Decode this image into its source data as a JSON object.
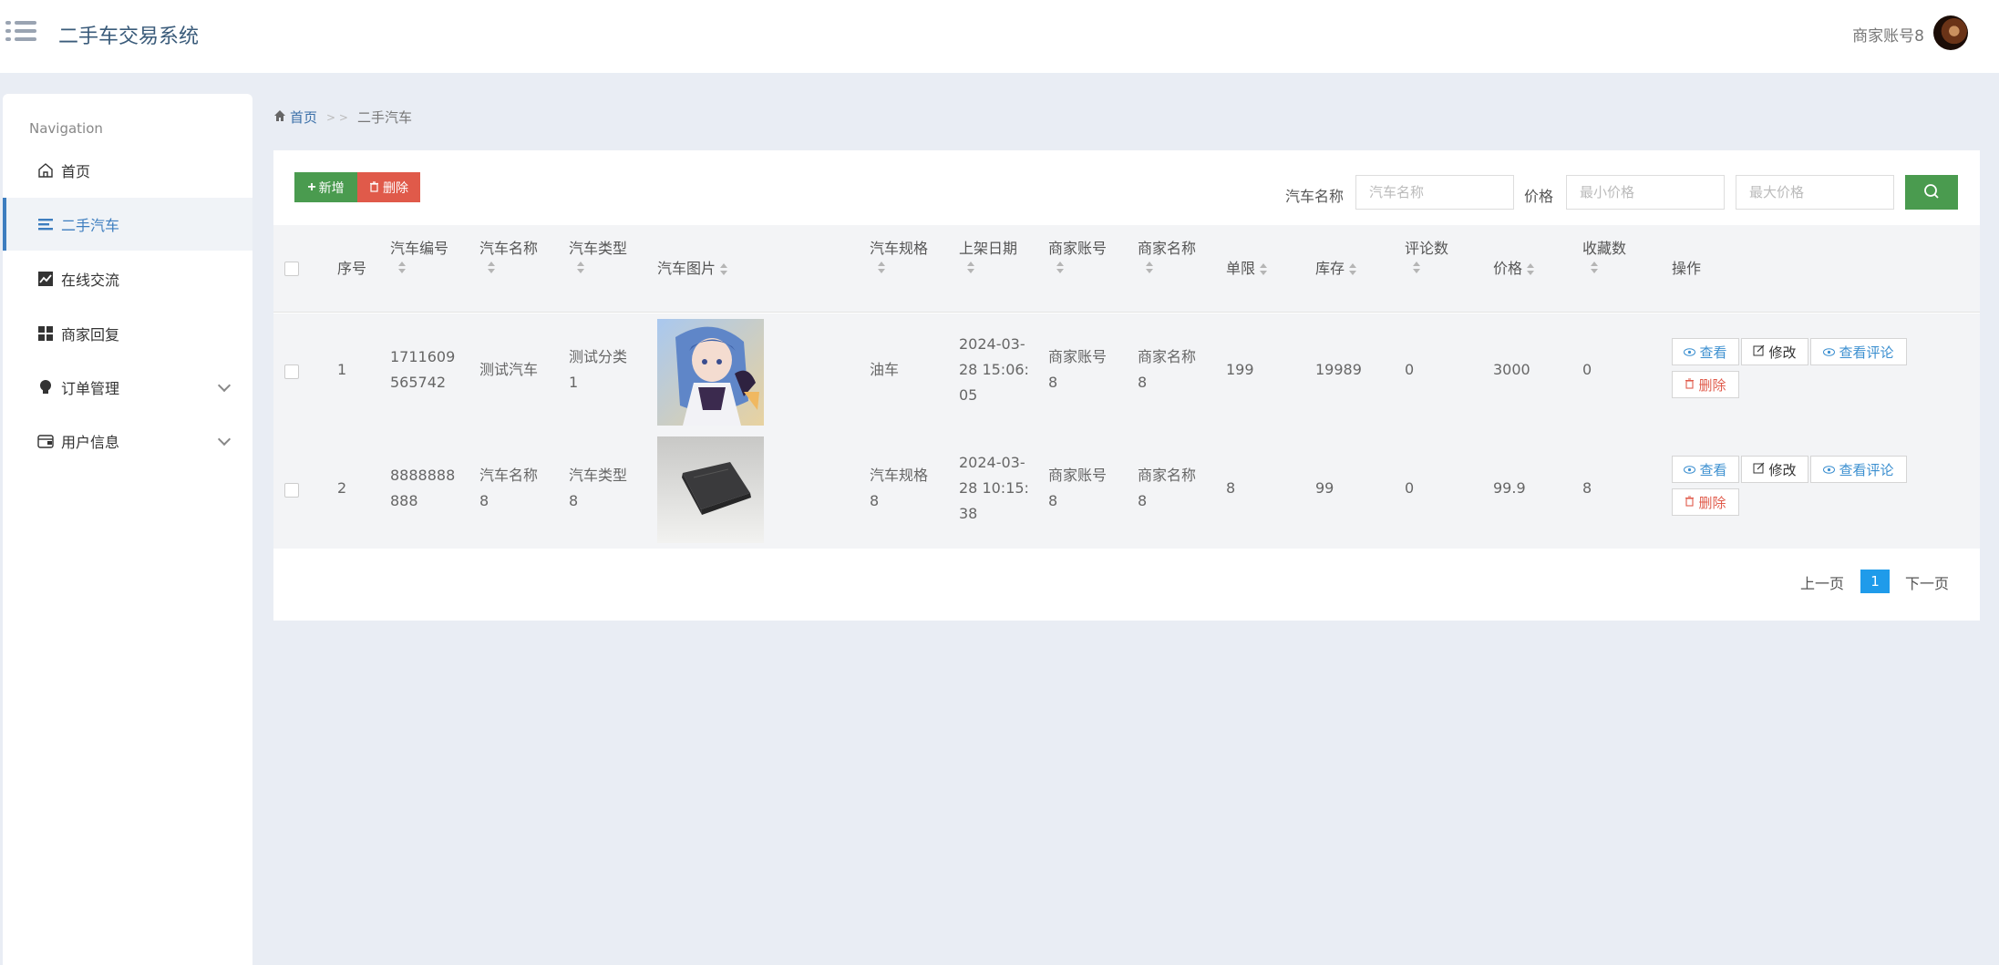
{
  "header": {
    "app_title": "二手车交易系统",
    "user_name": "商家账号8"
  },
  "sidebar": {
    "heading": "Navigation",
    "items": [
      {
        "label": "首页",
        "icon": "home-icon"
      },
      {
        "label": "二手汽车",
        "icon": "list-icon",
        "active": true
      },
      {
        "label": "在线交流",
        "icon": "chart-icon"
      },
      {
        "label": "商家回复",
        "icon": "grid-icon"
      },
      {
        "label": "订单管理",
        "icon": "bulb-icon",
        "expandable": true
      },
      {
        "label": "用户信息",
        "icon": "wallet-icon",
        "expandable": true
      }
    ]
  },
  "breadcrumb": {
    "home": "首页",
    "separator": "> >",
    "current": "二手汽车"
  },
  "toolbar": {
    "add_label": "新增",
    "delete_label": "删除",
    "car_name_label": "汽车名称",
    "car_name_placeholder": "汽车名称",
    "price_label": "价格",
    "min_price_placeholder": "最小价格",
    "max_price_placeholder": "最大价格"
  },
  "table": {
    "columns": {
      "index": "序号",
      "car_code": "汽车编号",
      "car_name": "汽车名称",
      "car_type": "汽车类型",
      "car_image": "汽车图片",
      "car_spec": "汽车规格",
      "listing_date": "上架日期",
      "merchant_account": "商家账号",
      "merchant_name": "商家名称",
      "limit": "单限",
      "stock": "库存",
      "comments": "评论数",
      "price": "价格",
      "favorites": "收藏数",
      "actions": "操作"
    },
    "rows": [
      {
        "index": "1",
        "car_code": [
          "1711609",
          "565742"
        ],
        "car_name": [
          "测试汽车"
        ],
        "car_type": [
          "测试分类",
          "1"
        ],
        "car_spec": [
          "油车"
        ],
        "listing_date": [
          "2024-03-",
          "28 15:06:",
          "05"
        ],
        "merchant_account": [
          "商家账号",
          "8"
        ],
        "merchant_name": [
          "商家名称",
          "8"
        ],
        "limit": "199",
        "stock": "19989",
        "comments": "0",
        "price": "3000",
        "favorites": "0"
      },
      {
        "index": "2",
        "car_code": [
          "8888888",
          "888"
        ],
        "car_name": [
          "汽车名称",
          "8"
        ],
        "car_type": [
          "汽车类型",
          "8"
        ],
        "car_spec": [
          "汽车规格",
          "8"
        ],
        "listing_date": [
          "2024-03-",
          "28 10:15:",
          "38"
        ],
        "merchant_account": [
          "商家账号",
          "8"
        ],
        "merchant_name": [
          "商家名称",
          "8"
        ],
        "limit": "8",
        "stock": "99",
        "comments": "0",
        "price": "99.9",
        "favorites": "8"
      }
    ],
    "action_labels": {
      "view": "查看",
      "edit": "修改",
      "view_comments": "查看评论",
      "delete": "删除"
    }
  },
  "pagination": {
    "prev": "上一页",
    "current": "1",
    "next": "下一页"
  }
}
